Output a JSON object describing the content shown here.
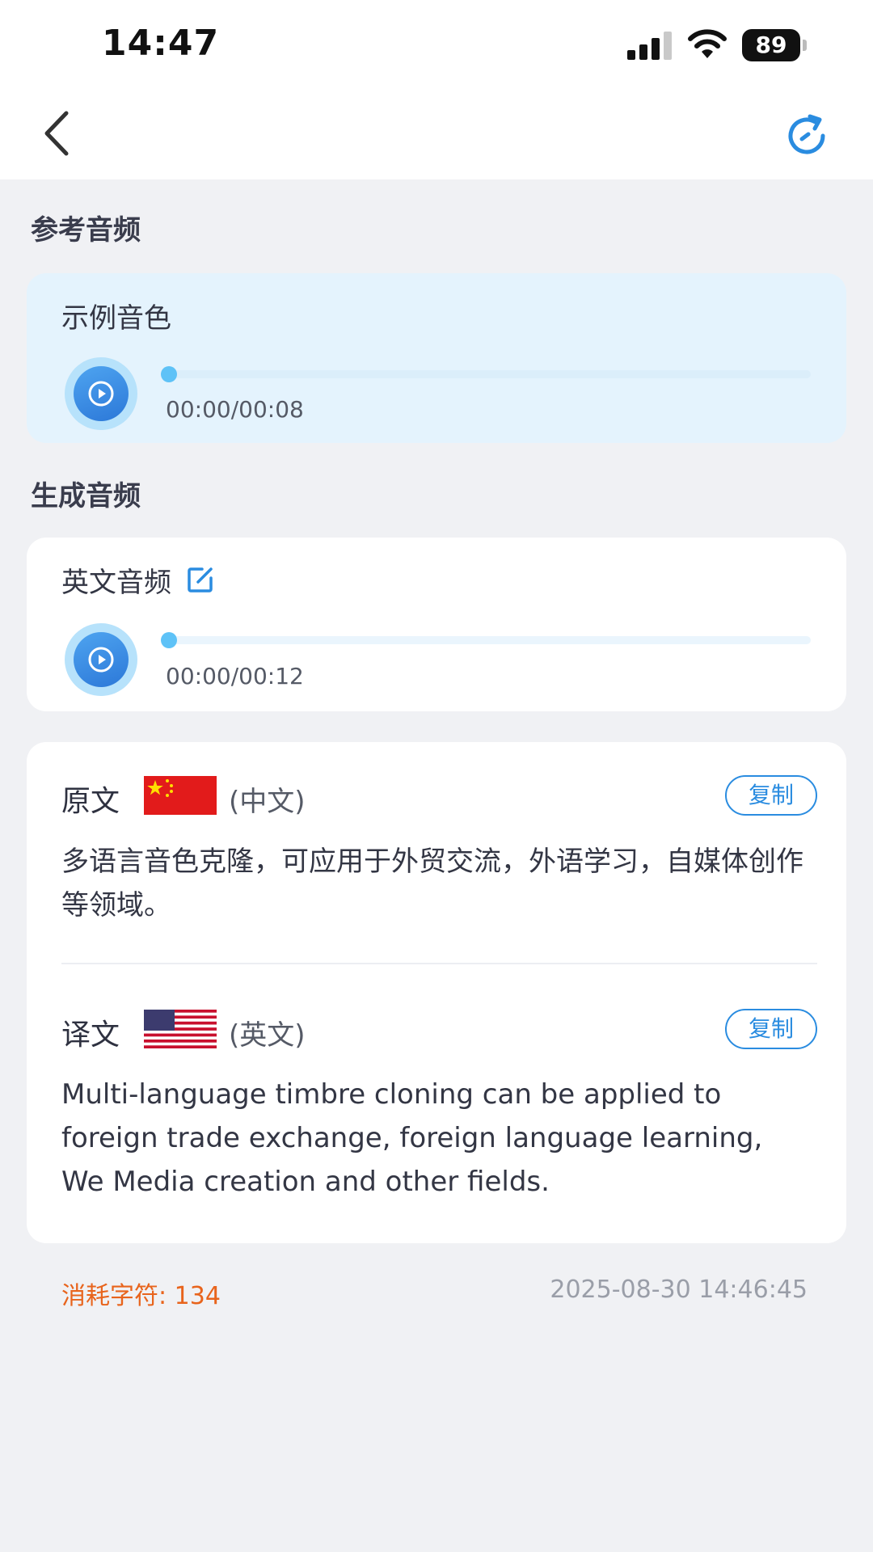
{
  "status_bar": {
    "time": "14:47",
    "battery": "89"
  },
  "nav": {
    "back_icon": "chevron-left-icon",
    "refresh_icon": "refresh-icon"
  },
  "reference": {
    "section_title": "参考音频",
    "card_label": "示例音色",
    "time_display": "00:00/00:08",
    "progress": 0
  },
  "generated": {
    "section_title": "生成音频",
    "card_label": "英文音频",
    "time_display": "00:00/00:12",
    "progress": 0
  },
  "original": {
    "label": "原文",
    "language": "(中文)",
    "copy_label": "复制",
    "text": "多语言音色克隆，可应用于外贸交流，外语学习，自媒体创作等领域。"
  },
  "translation": {
    "label": "译文",
    "language": "(英文)",
    "copy_label": "复制",
    "text": "Multi-language timbre cloning can be applied to foreign trade exchange, foreign language learning, We Media creation and other fields."
  },
  "footer": {
    "chars_consumed": "消耗字符: 134",
    "timestamp": "2025-08-30 14:46:45"
  },
  "colors": {
    "accent": "#2a8ce0",
    "warning": "#e8641c",
    "card_highlight": "#e4f3fd"
  }
}
